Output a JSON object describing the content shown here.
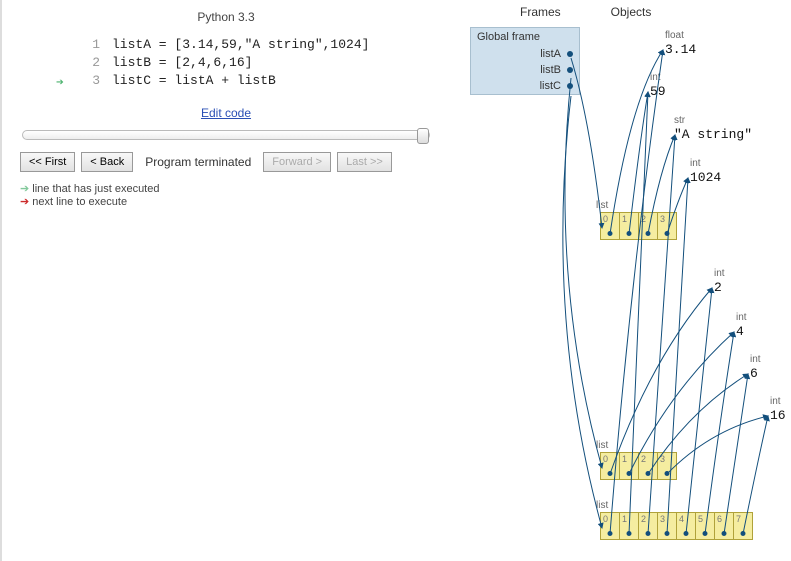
{
  "python_version": "Python 3.3",
  "code": {
    "lines": [
      {
        "n": "1",
        "text": "listA = [3.14,59,\"A string\",1024]"
      },
      {
        "n": "2",
        "text": "listB = [2,4,6,16]"
      },
      {
        "n": "3",
        "text": "listC = listA + listB"
      }
    ],
    "just_executed_line": 3
  },
  "edit_link": "Edit code",
  "controls": {
    "first": "<< First",
    "back": "< Back",
    "status": "Program terminated",
    "forward": "Forward >",
    "last": "Last >>"
  },
  "legend": {
    "executed": "line that has just executed",
    "next": "next line to execute"
  },
  "headers": {
    "frames": "Frames",
    "objects": "Objects"
  },
  "frame": {
    "title": "Global frame",
    "vars": [
      "listA",
      "listB",
      "listC"
    ]
  },
  "objects": {
    "float": {
      "type": "float",
      "value": "3.14"
    },
    "int59": {
      "type": "int",
      "value": "59"
    },
    "str": {
      "type": "str",
      "value": "\"A string\""
    },
    "int1024": {
      "type": "int",
      "value": "1024"
    },
    "int2": {
      "type": "int",
      "value": "2"
    },
    "int4": {
      "type": "int",
      "value": "4"
    },
    "int6": {
      "type": "int",
      "value": "6"
    },
    "int16": {
      "type": "int",
      "value": "16"
    },
    "listA": {
      "type": "list",
      "indices": [
        "0",
        "1",
        "2",
        "3"
      ]
    },
    "listB": {
      "type": "list",
      "indices": [
        "0",
        "1",
        "2",
        "3"
      ]
    },
    "listC": {
      "type": "list",
      "indices": [
        "0",
        "1",
        "2",
        "3",
        "4",
        "5",
        "6",
        "7"
      ]
    }
  }
}
